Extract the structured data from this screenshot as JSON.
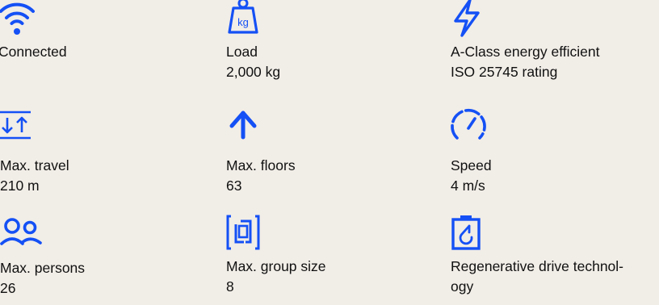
{
  "accent_color": "#1450f5",
  "features": [
    {
      "icon": "wifi-icon",
      "label": "Connected",
      "value": ""
    },
    {
      "icon": "weight-kg-icon",
      "icon_text": "kg",
      "label": "Load",
      "value": "2,000 kg"
    },
    {
      "icon": "lightning-icon",
      "label": "A-Class energy efficient",
      "value": "ISO 25745 rating"
    },
    {
      "icon": "travel-arrows-icon",
      "label": "Max. travel",
      "value": "210 m"
    },
    {
      "icon": "arrow-up-icon",
      "label": "Max. floors",
      "value": "63"
    },
    {
      "icon": "speedometer-icon",
      "label": "Speed",
      "value": "4 m/s"
    },
    {
      "icon": "persons-icon",
      "label": "Max. persons",
      "value": "26"
    },
    {
      "icon": "elevator-group-icon",
      "label": "Max. group size",
      "value": "8"
    },
    {
      "icon": "regenerative-battery-icon",
      "label": "Regenerative drive technol-",
      "value": "ogy"
    }
  ]
}
